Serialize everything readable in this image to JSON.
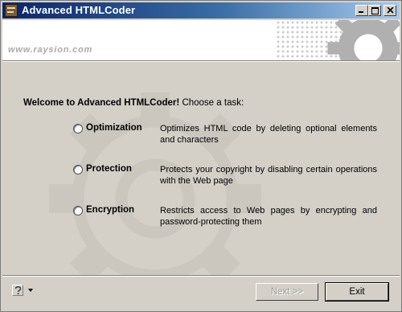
{
  "window": {
    "title": "Advanced HTMLCoder",
    "controls": [
      "minimize",
      "maximize",
      "close"
    ]
  },
  "banner": {
    "website": "www.raysion.com",
    "decoration_icon": "gear-icon"
  },
  "content": {
    "welcome_bold": "Welcome to Advanced HTMLCoder!",
    "welcome_rest": " Choose a task:",
    "tasks": [
      {
        "label": "Optimization",
        "description": "Optimizes HTML code by deleting optional elements and characters",
        "selected": false
      },
      {
        "label": "Protection",
        "description": "Protects your copyright by disabling certain operations with the Web page",
        "selected": false
      },
      {
        "label": "Encryption",
        "description": "Restricts access to Web pages by encrypting and password-protecting them",
        "selected": false
      }
    ]
  },
  "footer": {
    "help_icon": "help-icon",
    "next_label": "Next >>",
    "next_enabled": false,
    "exit_label": "Exit"
  },
  "colors": {
    "titlebar_start": "#0a246a",
    "titlebar_end": "#a6caf0",
    "dialog_background": "#d4d0c8",
    "website_text": "#a9a9a9"
  }
}
